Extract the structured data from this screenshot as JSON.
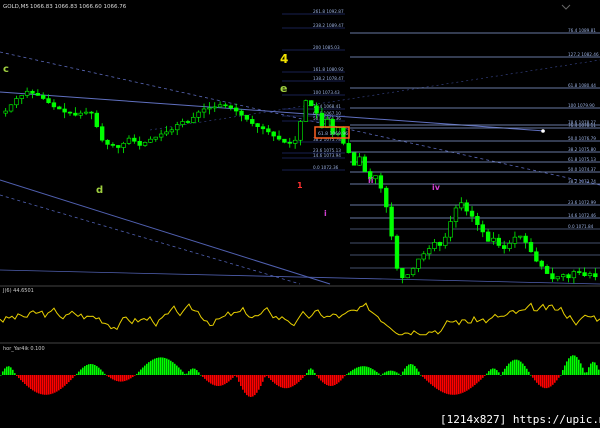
{
  "window": {
    "title": "GOLD,M5",
    "ohlc": "1066.83 1066.83 1066.60 1066.76"
  },
  "colors": {
    "background": "#000000",
    "candle": "#00ff00",
    "fib_line": "#8aa0d8",
    "trend_line": "#6070c0",
    "wave_yellow": "#f0e000",
    "wave_green": "#a0d040",
    "wave_red": "#ff3030",
    "wave_magenta": "#d040d0",
    "osc_line": "#e8d000",
    "hist_pos": "#00ff00",
    "hist_neg": "#ff0000",
    "highlight_box": "#ff6020"
  },
  "wave_labels": [
    {
      "text": "c",
      "color": "#a0d040"
    },
    {
      "text": "d",
      "color": "#a0d040"
    },
    {
      "text": "4",
      "color": "#f0e000"
    },
    {
      "text": "e",
      "color": "#a0d040"
    },
    {
      "text": "1",
      "color": "#ff3030"
    },
    {
      "text": "i",
      "color": "#d040d0"
    },
    {
      "text": "ii",
      "color": "#d040d0"
    },
    {
      "text": "iv",
      "color": "#d040d0"
    }
  ],
  "fib_upper": [
    "261.8 1092.87",
    "238.2 1089.47",
    "200 1085.03",
    "161.8 1080.92",
    "138.2 1078.47",
    "100 1073.43",
    "76.4 1068.41",
    "61.8 1067.10",
    "50.0 1061.36",
    "38.2 1075.78",
    "23.6 1075.13",
    "14.6 1073.94",
    "0.0 1072.36"
  ],
  "fib_right": [
    "76.4 1089.81",
    "127.2 1082.46",
    "61.8 1080.44",
    "100 1079.90",
    "78.6 1078.27",
    "76.4 1078.11",
    "50.0 1076.79",
    "38.2 1075.80",
    "61.8 1075.13",
    "50.0 1074.37",
    "38.2 1073.74",
    "23.6 1072.99",
    "14.6 1072.46",
    "0.0 1071.84"
  ],
  "highlight_box_text": "61.8 1069.96",
  "indicator1": {
    "label": "J(6) 44.6501"
  },
  "indicator2": {
    "label": "hor_Yar4ik 0.100"
  },
  "watermark": "[1214x827] https://upic.me/",
  "chart_data": {
    "type": "candlestick",
    "symbol": "GOLD",
    "timeframe": "M5",
    "price_series": [
      1079.0,
      1079.6,
      1080.2,
      1080.5,
      1080.9,
      1080.7,
      1080.5,
      1080.2,
      1079.8,
      1079.4,
      1079.2,
      1078.9,
      1078.8,
      1078.6,
      1078.8,
      1078.9,
      1078.8,
      1077.5,
      1076.2,
      1075.8,
      1075.7,
      1075.5,
      1075.9,
      1076.4,
      1076.1,
      1075.7,
      1076.0,
      1076.3,
      1076.5,
      1076.8,
      1077.0,
      1077.2,
      1077.7,
      1078.0,
      1077.9,
      1078.4,
      1078.9,
      1079.2,
      1079.3,
      1079.4,
      1079.6,
      1079.5,
      1079.3,
      1079.0,
      1078.6,
      1078.2,
      1077.8,
      1077.5,
      1077.3,
      1077.0,
      1076.6,
      1076.3,
      1076.0,
      1075.9,
      1076.2,
      1078.0,
      1080.0,
      1079.5,
      1078.8,
      1077.4,
      1078.2,
      1076.8,
      1077.4,
      1075.9,
      1075.0,
      1073.8,
      1074.6,
      1073.2,
      1072.5,
      1072.8,
      1071.6,
      1069.8,
      1067.0,
      1063.9,
      1063.0,
      1063.3,
      1063.9,
      1064.8,
      1065.3,
      1065.8,
      1066.4,
      1066.1,
      1066.9,
      1068.4,
      1069.7,
      1070.2,
      1069.4,
      1068.9,
      1068.1,
      1067.4,
      1066.5,
      1066.8,
      1066.1,
      1065.8,
      1066.3,
      1066.9,
      1067.0,
      1066.4,
      1065.5,
      1064.6,
      1064.1,
      1063.4,
      1062.9,
      1063.1,
      1063.3,
      1063.0,
      1063.6,
      1063.5,
      1063.2,
      1063.4,
      1063.1
    ],
    "oscillator": {
      "name": "J(6)",
      "value": 44.6501,
      "ylim": [
        0,
        100
      ]
    },
    "histogram": {
      "name": "hor_Yar4ik",
      "value": 0.1
    }
  }
}
